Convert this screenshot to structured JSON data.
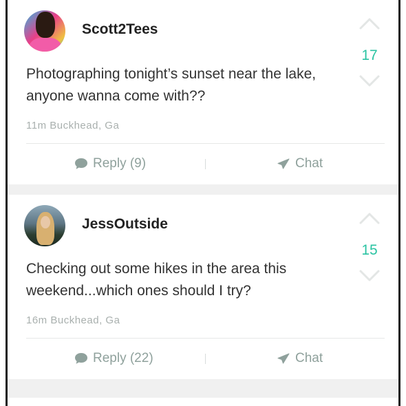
{
  "posts": [
    {
      "username": "Scott2Tees",
      "text": "Photographing tonight’s sunset near the lake, anyone wanna come with??",
      "meta": "11m Buckhead, Ga",
      "score": "17",
      "reply_label": "Reply (9)",
      "chat_label": "Chat"
    },
    {
      "username": "JessOutside",
      "text": "Checking out some hikes in the area this weekend...which ones should I try?",
      "meta": "16m Buckhead, Ga",
      "score": "15",
      "reply_label": "Reply (22)",
      "chat_label": "Chat"
    }
  ],
  "colors": {
    "score": "#2ac3a2",
    "action": "#8fa19c",
    "meta": "#a9b0ae",
    "card_gap": "#f0f0f0"
  },
  "icons": {
    "upvote": "chevron-up-icon",
    "downvote": "chevron-down-icon",
    "reply": "speech-bubble-icon",
    "chat": "paper-plane-icon"
  }
}
